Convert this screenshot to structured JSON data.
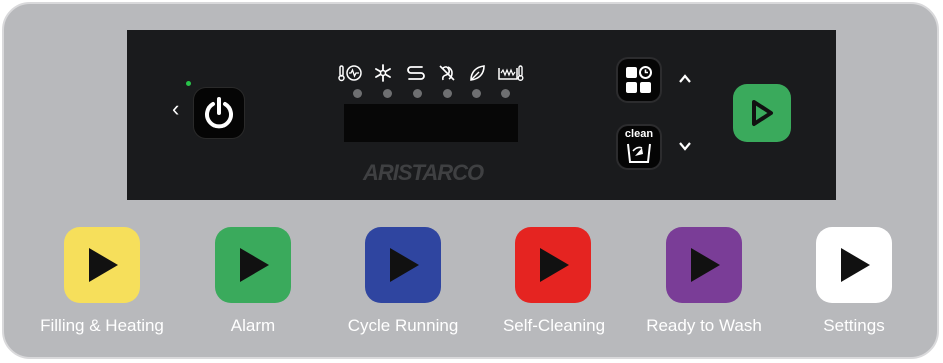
{
  "brand": "ARISTARCO",
  "mode_icons": [
    "thermometer-wave-icon",
    "snowflake-icon",
    "rinse-icon",
    "no-rinse-icon",
    "eco-leaf-icon",
    "tank-heat-icon"
  ],
  "controls": {
    "power": "power-icon",
    "programs": "programs-icon",
    "clean_label": "clean",
    "up": "chevron-up-icon",
    "down": "chevron-down-icon",
    "start": "play-icon"
  },
  "states": [
    {
      "label": "Filling & Heating",
      "color": "#f6df5b"
    },
    {
      "label": "Alarm",
      "color": "#3aaa5c"
    },
    {
      "label": "Cycle Running",
      "color": "#2f45a0"
    },
    {
      "label": "Self-Cleaning",
      "color": "#e52421"
    },
    {
      "label": "Ready to Wash",
      "color": "#7a3d97"
    },
    {
      "label": "Settings",
      "color": "#ffffff"
    }
  ]
}
